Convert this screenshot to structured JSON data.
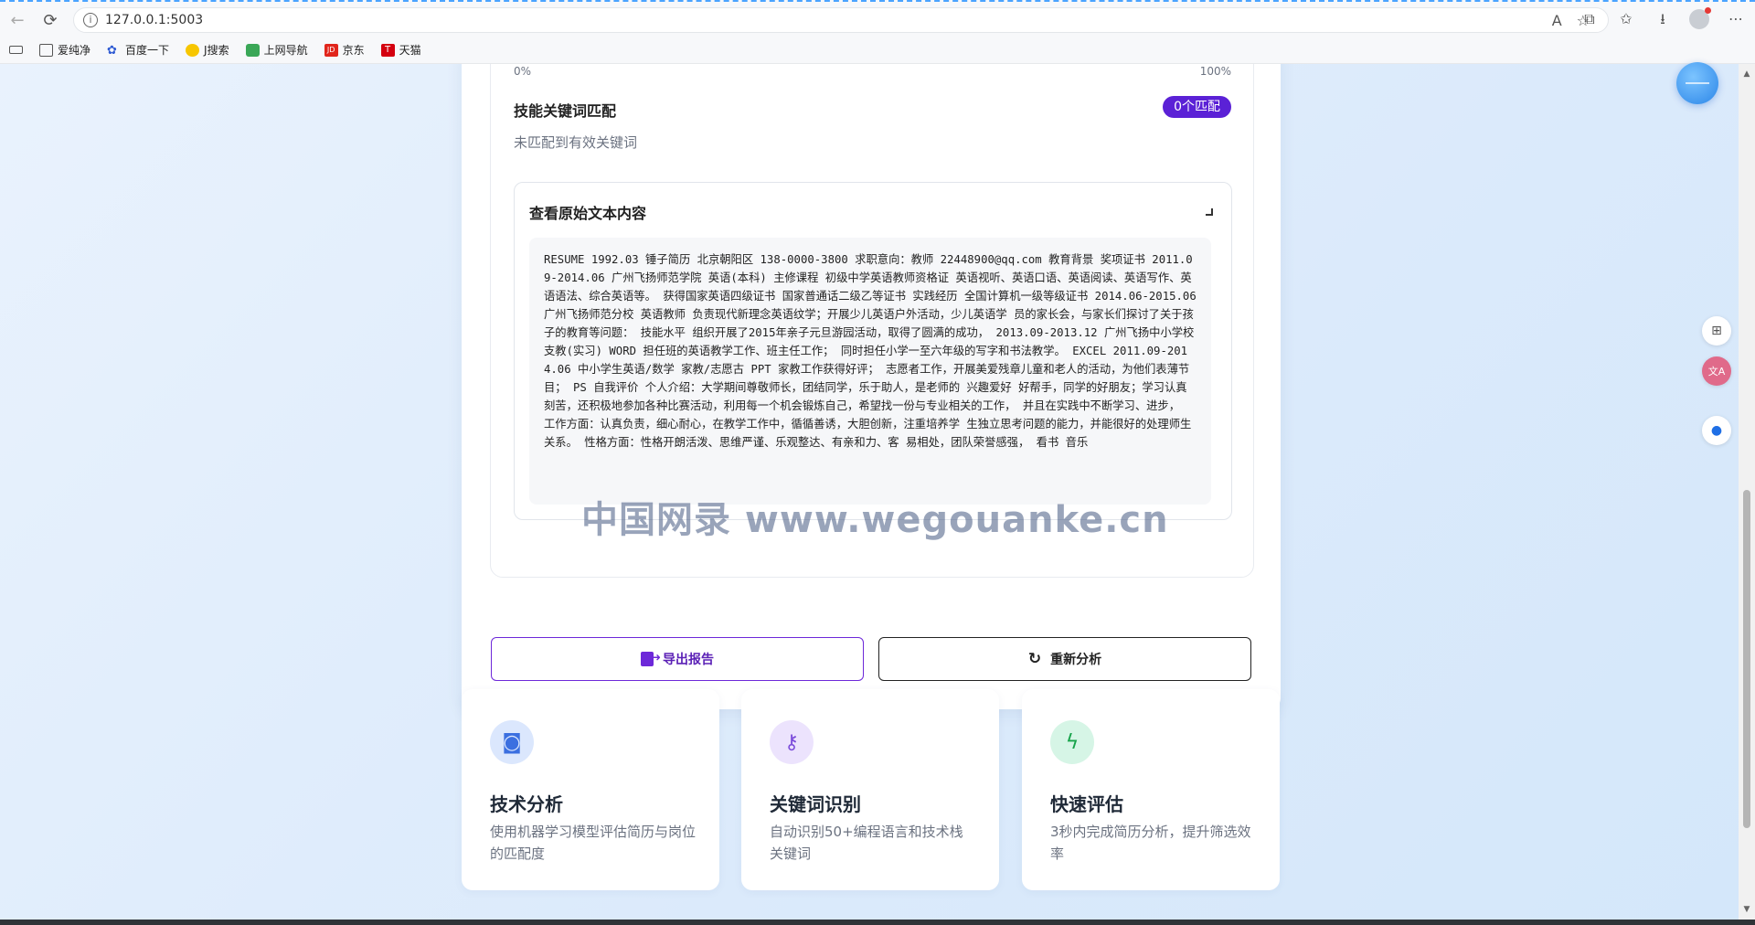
{
  "browser": {
    "url": "127.0.0.1:5003",
    "bookmarks": [
      "爱纯净",
      "百度一下",
      "J搜索",
      "上网导航",
      "京东",
      "天猫"
    ]
  },
  "progress": {
    "min_label": "0%",
    "max_label": "100%"
  },
  "skills": {
    "title": "技能关键词匹配",
    "badge": "0个匹配",
    "empty_text": "未匹配到有效关键词"
  },
  "raw": {
    "title": "查看原始文本内容",
    "text": "RESUME 1992.03 锤子简历 北京朝阳区 138-0000-3800 求职意向：教师 22448900@qq.com 教育背景 奖项证书 2011.09-2014.06 广州飞扬师范学院 英语(本科) 主修课程 初级中学英语教师资格证 英语视听、英语口语、英语阅读、英语写作、英语语法、综合英语等。 获得国家英语四级证书 国家普通话二级乙等证书 实践经历 全国计算机一级等级证书 2014.06-2015.06 广州飞扬师范分校 英语教师 负责现代新理念英语纹学；开展少儿英语户外活动，少儿英语学 员的家长会，与家长们探讨了关于孩子的教育等问题： 技能水平 组织开展了2015年亲子元旦游园活动，取得了圆满的成功， 2013.09-2013.12 广州飞扬中小学校 支教(实习) WORD 担任班的英语教学工作、班主任工作； 同时担任小学一至六年级的写字和书法教学。 EXCEL 2011.09-2014.06 中小学生英语/数学 家教/志愿古 PPT 家教工作获得好评； 志愿者工作，开展美爱残章儿童和老人的活动，为他们表薄节目； PS 自我评价 个人介绍：大学期间尊敬师长，团结同学，乐于助人，是老师的 兴趣爱好 好帮手，同学的好朋友；学习认真刻苦，还积极地参加各种比赛活动，利用每一个机会锻炼自己，希望找一份与专业相关的工作， 并且在实践中不断学习、进步， 工作方面：认真负责，细心耐心，在教学工作中，循循善诱，大胆创新，注重培养学 生独立思考问题的能力，并能很好的处理师生关系。 性格方面：性格开朗活泼、思维严谨、乐观整达、有亲和力、客 易相处，团队荣誉感强， 看书 音乐"
  },
  "buttons": {
    "export": "导出报告",
    "reanalyze": "重新分析"
  },
  "features": [
    {
      "title": "技术分析",
      "desc": "使用机器学习模型评估简历与岗位的匹配度",
      "icon": "robot-icon",
      "bg": "#dbe7fd",
      "fg": "#3b6fe0"
    },
    {
      "title": "关键词识别",
      "desc": "自动识别50+编程语言和技术栈关键词",
      "icon": "key-icon",
      "bg": "#ece3fd",
      "fg": "#7c4ddb"
    },
    {
      "title": "快速评估",
      "desc": "3秒内完成简历分析，提升筛选效率",
      "icon": "bolt-icon",
      "bg": "#d6f5e6",
      "fg": "#16a34a"
    }
  ],
  "watermark": "中国网录 www.wegouanke.cn",
  "colors": {
    "accent": "#5b21d6",
    "page_bg": "#dbeafb"
  }
}
